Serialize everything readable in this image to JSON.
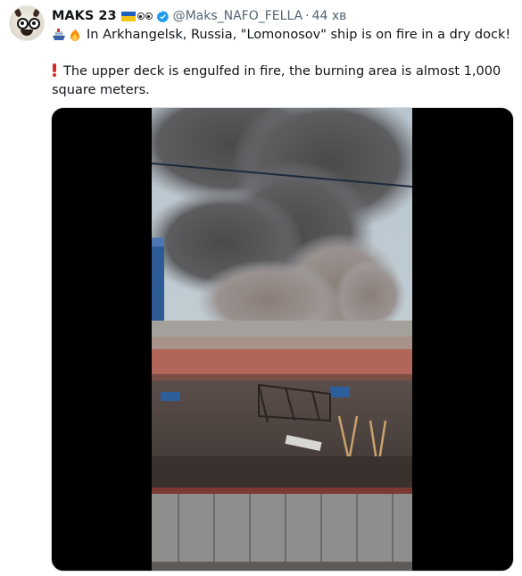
{
  "tweet": {
    "author_name": "MAKS 23",
    "handle": "@Maks_NAFO_FELLA",
    "separator": "·",
    "time_ago": "44 хв",
    "line1_text": "In Arkhangelsk, Russia, \"Lomonosov\" ship is on fire in a dry dock!",
    "line2_text": "The upper deck is engulfed in fire, the burning area is almost 1,000 square meters."
  },
  "icons": {
    "avatar": "avatar-image",
    "flag": "ukraine-flag-icon",
    "eyes": "eyes-emoji-icon",
    "verified": "verified-badge-icon",
    "ship": "ship-emoji-icon",
    "fire": "fire-emoji-icon",
    "exclamation": "red-exclamation-icon"
  },
  "colors": {
    "text": "#0f1419",
    "muted": "#536471",
    "verified": "#1d9bf0",
    "flag_blue": "#1f5fbf",
    "flag_yellow": "#f2c418"
  }
}
